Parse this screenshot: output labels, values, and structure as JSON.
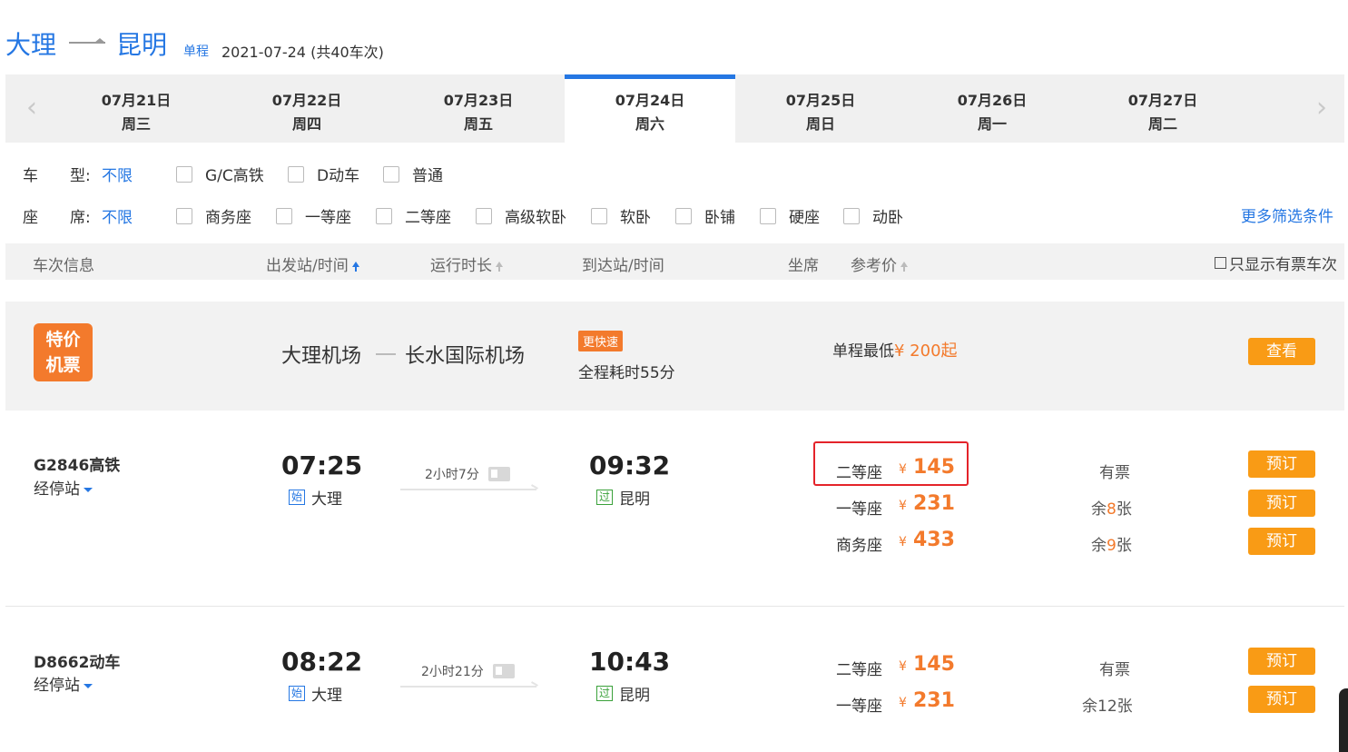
{
  "header": {
    "from": "大理",
    "to": "昆明",
    "trip_type": "单程",
    "date_summary": "2021-07-24 (共40车次)"
  },
  "date_tabs": [
    {
      "date": "07月21日",
      "weekday": "周三"
    },
    {
      "date": "07月22日",
      "weekday": "周四"
    },
    {
      "date": "07月23日",
      "weekday": "周五"
    },
    {
      "date": "07月24日",
      "weekday": "周六",
      "active": true
    },
    {
      "date": "07月25日",
      "weekday": "周日"
    },
    {
      "date": "07月26日",
      "weekday": "周一"
    },
    {
      "date": "07月27日",
      "weekday": "周二"
    }
  ],
  "filters": {
    "train_type": {
      "label_a": "车",
      "label_b": "型:",
      "value": "不限",
      "options": [
        "G/C高铁",
        "D动车",
        "普通"
      ]
    },
    "seat": {
      "label_a": "座",
      "label_b": "席:",
      "value": "不限",
      "options": [
        "商务座",
        "一等座",
        "二等座",
        "高级软卧",
        "软卧",
        "卧铺",
        "硬座",
        "动卧"
      ]
    },
    "more": "更多筛选条件"
  },
  "columns": {
    "info": "车次信息",
    "depart": "出发站/时间",
    "duration": "运行时长",
    "arrive": "到达站/时间",
    "seat": "坐席",
    "price": "参考价",
    "only_available": "只显示有票车次"
  },
  "promo": {
    "badge_line1": "特价",
    "badge_line2": "机票",
    "from": "大理机场",
    "to": "长水国际机场",
    "fast_tag": "更快速",
    "duration": "全程耗时55分",
    "price_label": "单程最低",
    "price_value": "¥ 200起",
    "button": "查看"
  },
  "trains": [
    {
      "number": "G2846高铁",
      "stops": "经停站",
      "depart_time": "07:25",
      "depart_tag": "始",
      "depart_station": "大理",
      "duration": "2小时7分",
      "arrive_time": "09:32",
      "arrive_tag": "过",
      "arrive_station": "昆明",
      "seats": [
        {
          "name": "二等座",
          "yen": "¥",
          "price": "145",
          "avail_pre": "有票",
          "avail_num": "",
          "avail_post": "",
          "button": "预订"
        },
        {
          "name": "一等座",
          "yen": "¥",
          "price": "231",
          "avail_pre": "余",
          "avail_num": "8",
          "avail_post": "张",
          "button": "预订"
        },
        {
          "name": "商务座",
          "yen": "¥",
          "price": "433",
          "avail_pre": "余",
          "avail_num": "9",
          "avail_post": "张",
          "button": "预订"
        }
      ]
    },
    {
      "number": "D8662动车",
      "stops": "经停站",
      "depart_time": "08:22",
      "depart_tag": "始",
      "depart_station": "大理",
      "duration": "2小时21分",
      "arrive_time": "10:43",
      "arrive_tag": "过",
      "arrive_station": "昆明",
      "seats": [
        {
          "name": "二等座",
          "yen": "¥",
          "price": "145",
          "avail_pre": "有票",
          "avail_num": "",
          "avail_post": "",
          "button": "预订"
        },
        {
          "name": "一等座",
          "yen": "¥",
          "price": "231",
          "avail_pre": "余12张",
          "avail_num": "",
          "avail_post": "",
          "button": "预订"
        }
      ]
    }
  ],
  "colors": {
    "accent": "#2577e3",
    "orange": "#f37a2c",
    "button": "#f99b15",
    "highlight": "#e4232a"
  }
}
